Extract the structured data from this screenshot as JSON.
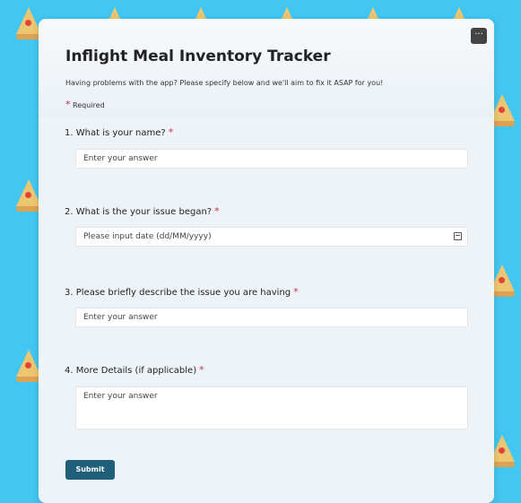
{
  "form": {
    "title": "Inflight Meal Inventory Tracker",
    "description": "Having problems with the app? Please specify below and we'll aim to fix it ASAP for you!",
    "required_mark": "*",
    "required_label": "Required",
    "more_icon": "more-horizontal-icon",
    "more_glyph": "···",
    "questions": [
      {
        "number": "1.",
        "label": "What is your name?",
        "placeholder": "Enter your answer",
        "type": "text"
      },
      {
        "number": "2.",
        "label": "What is the your issue began?",
        "placeholder": "Please input date (dd/MM/yyyy)",
        "type": "date",
        "icon": "calendar-icon"
      },
      {
        "number": "3.",
        "label": "Please briefly describe the issue you are having",
        "placeholder": "Enter your answer",
        "type": "text"
      },
      {
        "number": "4.",
        "label": "More Details (if applicable)",
        "placeholder": "Enter your answer",
        "type": "textarea"
      }
    ],
    "submit_label": "Submit"
  },
  "colors": {
    "background": "#43c6f2",
    "accent": "#1f5f7a",
    "required": "#c4314b"
  }
}
